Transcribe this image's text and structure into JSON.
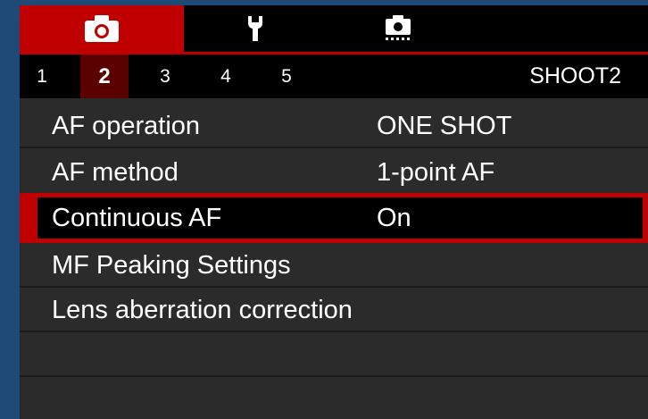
{
  "category_tabs": [
    {
      "icon": "camera-icon",
      "active": true
    },
    {
      "icon": "wrench-icon",
      "active": false
    },
    {
      "icon": "custom-camera-icon",
      "active": false
    }
  ],
  "pages": {
    "numbers": [
      "1",
      "2",
      "3",
      "4",
      "5"
    ],
    "active": "2",
    "title": "SHOOT2"
  },
  "menu": {
    "items": [
      {
        "label": "AF operation",
        "value": "ONE SHOT"
      },
      {
        "label": "AF method",
        "value": "1-point AF"
      },
      {
        "label": "Continuous AF",
        "value": "On",
        "selected": true
      },
      {
        "label": "MF Peaking Settings",
        "value": ""
      },
      {
        "label": "Lens aberration correction",
        "value": ""
      },
      {
        "label": "",
        "value": ""
      },
      {
        "label": "",
        "value": ""
      }
    ]
  },
  "colors": {
    "accent": "#c00000",
    "background": "#2b2b2b",
    "frame": "#1f4a78"
  }
}
